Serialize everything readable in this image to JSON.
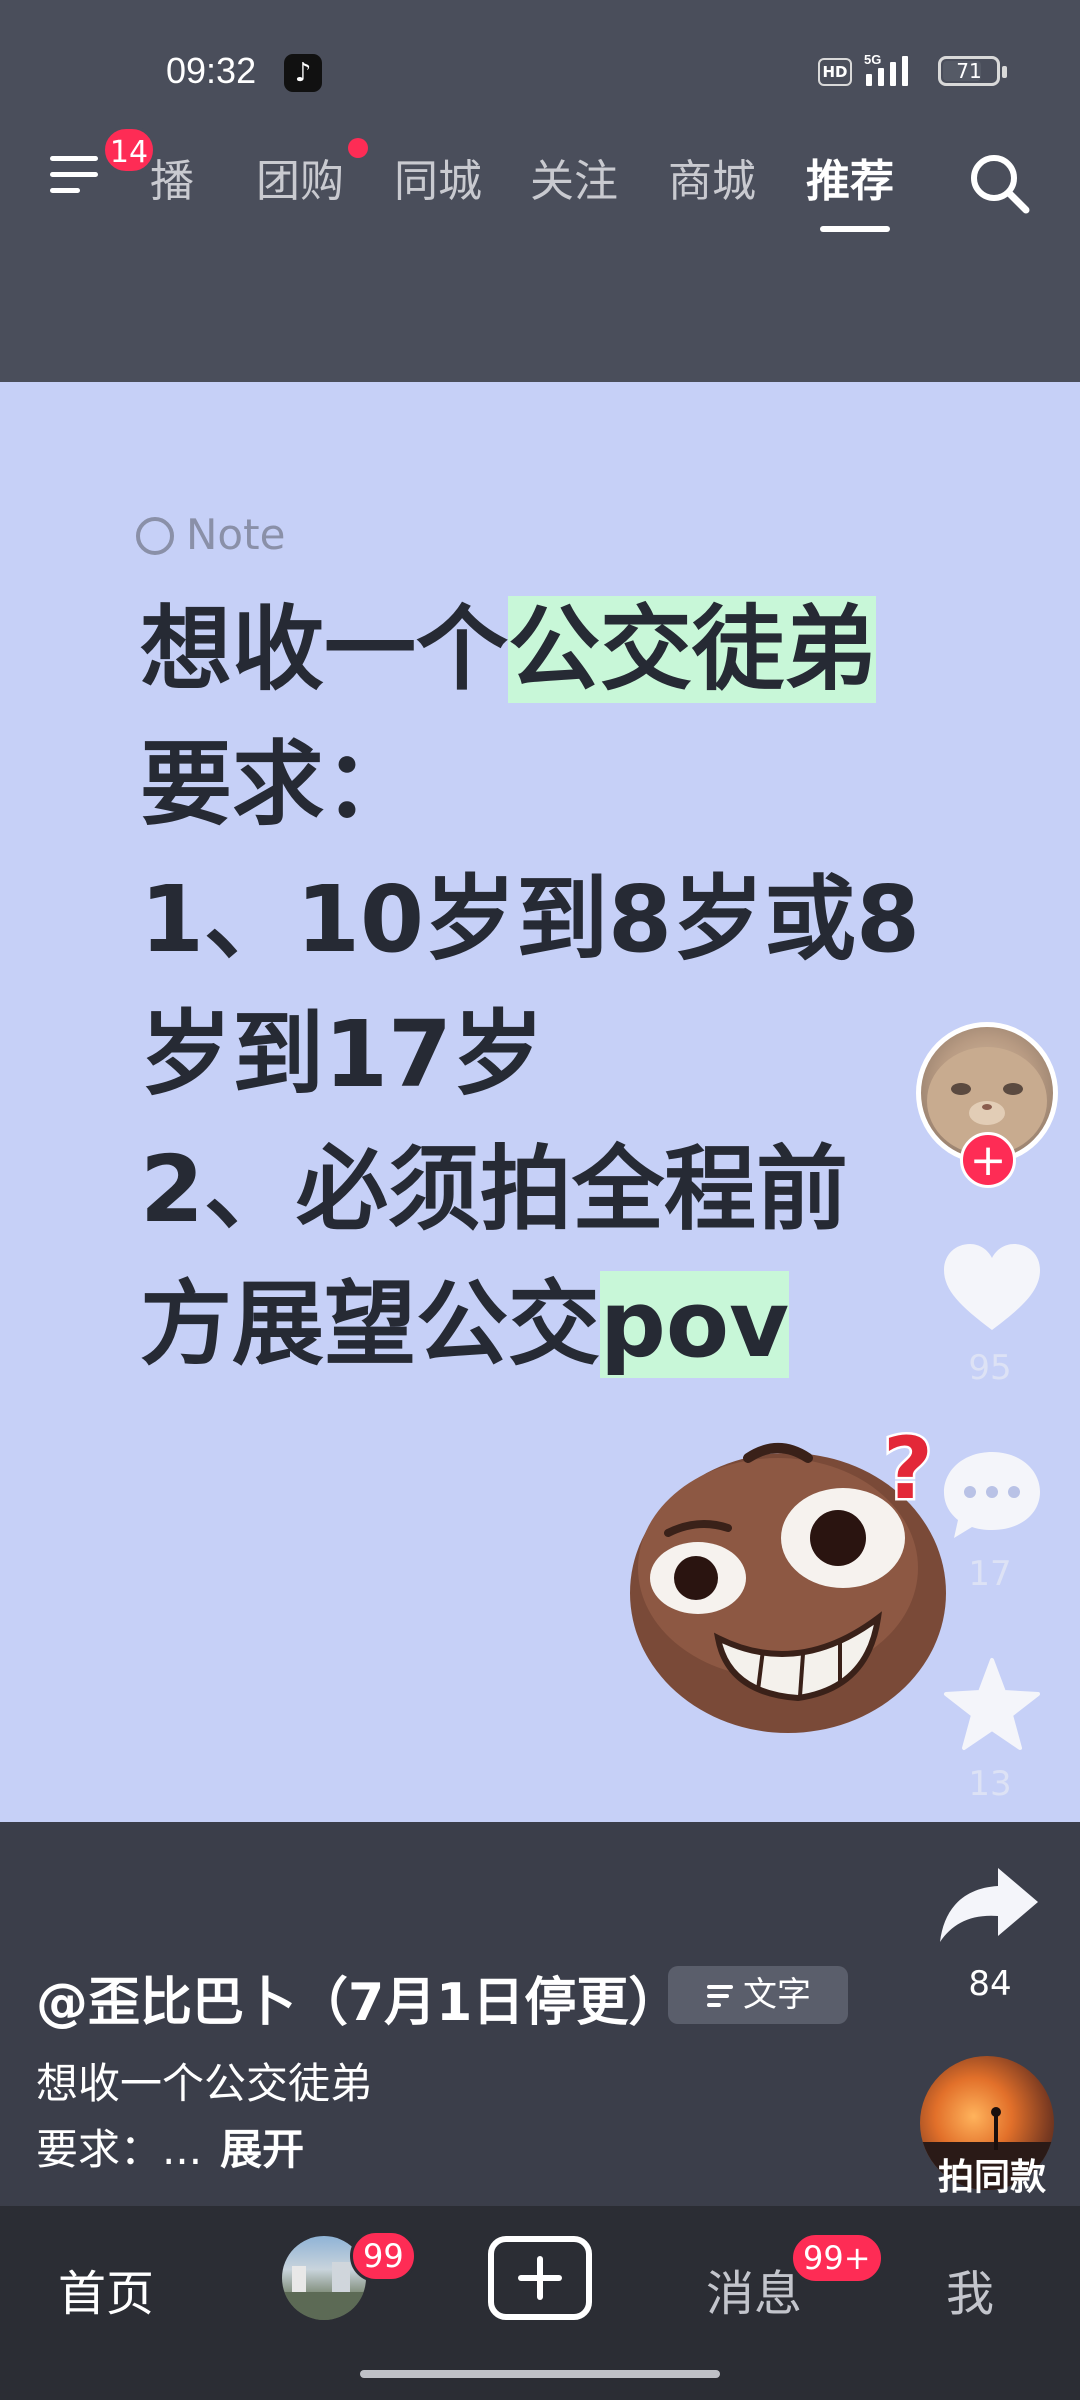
{
  "status_bar": {
    "time": "09:32",
    "hd_label": "HD",
    "network_label": "5G",
    "battery_level": "71"
  },
  "top_nav": {
    "menu_badge": "14",
    "tabs": [
      "播",
      "团购",
      "同城",
      "关注",
      "商城",
      "推荐"
    ],
    "active_tab": "推荐"
  },
  "post": {
    "note_label": "Note",
    "lines": [
      {
        "pre": "想收一个",
        "highlight": "公交徒弟",
        "post": ""
      },
      {
        "pre": "要求：",
        "highlight": "",
        "post": ""
      },
      {
        "pre": "1、10岁到8岁或8",
        "highlight": "",
        "post": ""
      },
      {
        "pre": "岁到17岁",
        "highlight": "",
        "post": ""
      },
      {
        "pre": "2、必须拍全程前",
        "highlight": "",
        "post": ""
      },
      {
        "pre": "方展望公交",
        "highlight": "pov",
        "post": ""
      }
    ],
    "question_mark": "?"
  },
  "actions": {
    "follow_plus": "+",
    "likes": "95",
    "comments": "17",
    "favorites": "13",
    "shares": "84"
  },
  "info": {
    "author": "@歪比巴卜（7月1日停更）",
    "text_chip": "文字",
    "caption_line1": "想收一个公交徒弟",
    "caption_line2": "要求：...",
    "expand_label": "展开",
    "same_style_label": "拍同款"
  },
  "bottom_nav": {
    "home": "首页",
    "friends_badge": "99",
    "messages": "消息",
    "messages_badge": "99+",
    "me": "我"
  },
  "colors": {
    "accent": "#fe2c55",
    "card_bg": "#c6d0f7",
    "highlight": "#c8f7d8",
    "header_bg": "#4a4e5b"
  }
}
